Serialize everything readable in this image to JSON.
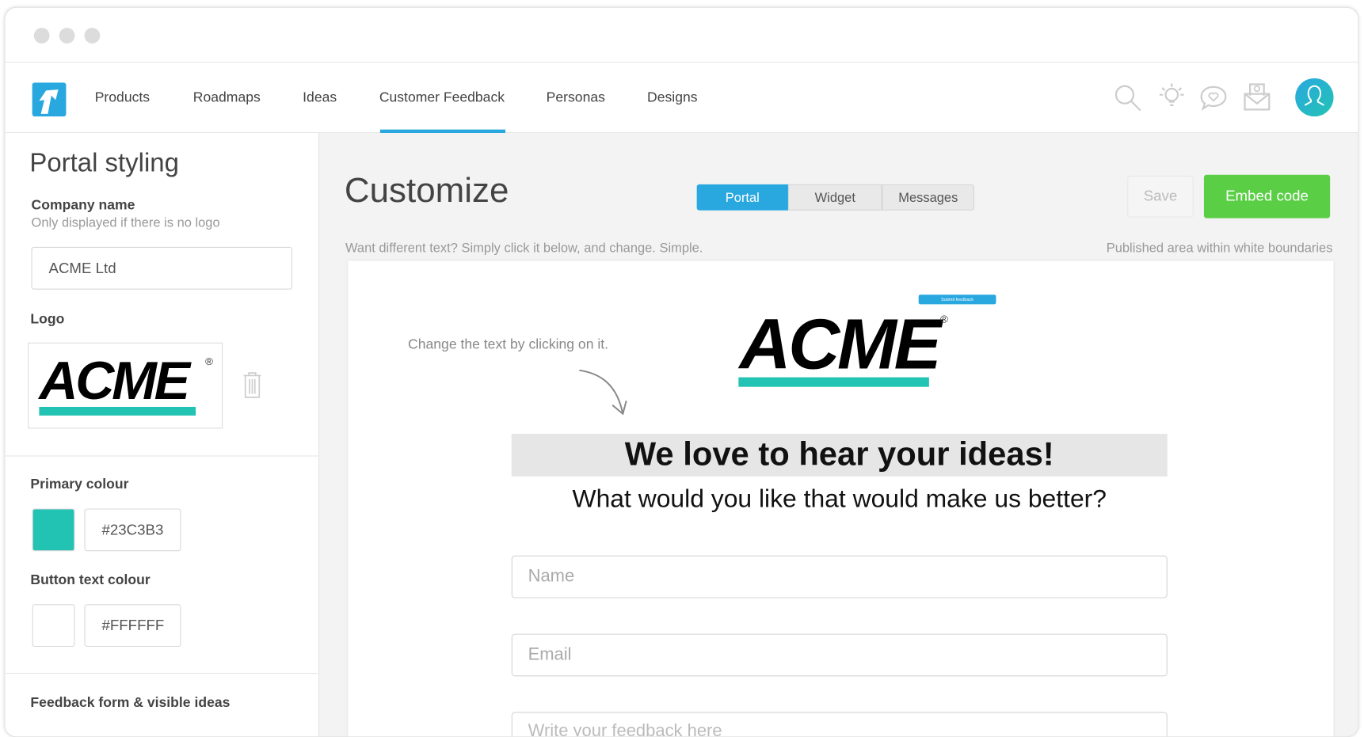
{
  "nav": {
    "items": [
      {
        "label": "Products"
      },
      {
        "label": "Roadmaps"
      },
      {
        "label": "Ideas"
      },
      {
        "label": "Customer Feedback",
        "active": true
      },
      {
        "label": "Personas"
      },
      {
        "label": "Designs"
      }
    ],
    "icons": [
      "search-icon",
      "lightbulb-icon",
      "chat-heart-icon",
      "contact-envelope-icon",
      "user-avatar-icon"
    ],
    "accent": "#29a8e0"
  },
  "sidebar": {
    "title": "Portal styling",
    "company_label": "Company name",
    "company_help": "Only displayed if there is no logo",
    "company_value": "ACME Ltd",
    "logo_label": "Logo",
    "logo_text": "ACME",
    "logo_mark": "®",
    "primary_label": "Primary colour",
    "primary_value": "#23C3B3",
    "button_text_label": "Button text colour",
    "button_text_value": "#FFFFFF",
    "feedback_label": "Feedback form & visible ideas"
  },
  "main": {
    "title": "Customize",
    "tabs": [
      {
        "label": "Portal",
        "active": true
      },
      {
        "label": "Widget"
      },
      {
        "label": "Messages"
      }
    ],
    "save_label": "Save",
    "embed_label": "Embed code",
    "embed_color": "#5acf46",
    "hint_left": "Want different text? Simply click it below, and change. Simple.",
    "hint_right": "Published area within white boundaries"
  },
  "preview": {
    "submit_label": "Submit feedback",
    "logo_text": "ACME",
    "logo_mark": "®",
    "annotation": "Change the text by clicking on it.",
    "headline": "We love to hear your ideas!",
    "subheadline": "What would you like that would make us better?",
    "name_placeholder": "Name",
    "email_placeholder": "Email",
    "feedback_placeholder": "Write your feedback here"
  }
}
